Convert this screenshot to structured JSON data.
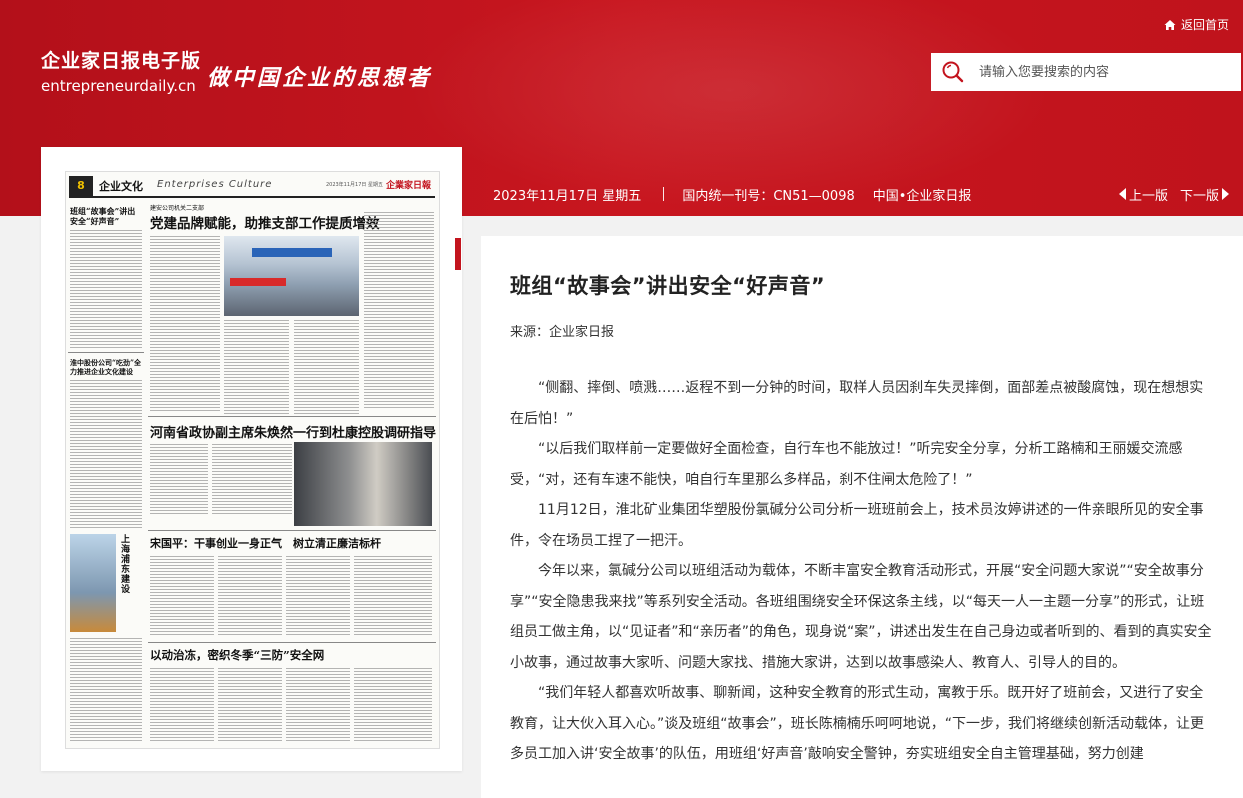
{
  "header": {
    "brand_cn": "企业家日报电子版",
    "brand_en": "entrepreneurdaily.cn",
    "slogan": "做中国企业的思想者",
    "home_label": "返回首页",
    "search_placeholder": "请输入您要搜索的内容",
    "home_icon": "home-icon",
    "search_icon": "search-icon"
  },
  "infobar": {
    "date": "2023年11月17日 星期五",
    "issn": "国内统一刊号：CN51—0098",
    "paper_name": "中国•企业家日报",
    "prev_label": "上一版",
    "next_label": "下一版"
  },
  "newspaper_page": {
    "page_number": "8",
    "section_cn": "企业文化",
    "section_en": "Enterprises Culture",
    "logo": "企業家日報",
    "date_line": "2023年11月17日 星期五",
    "headlines": {
      "h1_kicker": "建安公司机关二支部",
      "h1": "党建品牌赋能，助推支部工作提质增效",
      "side1": "班组“故事会”讲出安全“好声音”",
      "side2": "淮中股份公司“吃劲”全力推进企业文化建设",
      "h2": "河南省政协副主席朱焕然一行到杜康控股调研指导",
      "h3": "宋国平：干事创业一身正气　树立清正廉洁标杆",
      "h4": "以动治冻，密织冬季“三防”安全网",
      "v1": "上海浦东建设"
    }
  },
  "article": {
    "title": "班组“故事会”讲出安全“好声音”",
    "source": "来源：企业家日报",
    "paragraphs": [
      "“侧翻、摔倒、喷溅……返程不到一分钟的时间，取样人员因刹车失灵摔倒，面部差点被酸腐蚀，现在想想实在后怕！”",
      "“以后我们取样前一定要做好全面检查，自行车也不能放过！”听完安全分享，分析工路楠和王丽媛交流感受，“对，还有车速不能快，咱自行车里那么多样品，刹不住闸太危险了！”",
      "11月12日，淮北矿业集团华塑股份氯碱分公司分析一班班前会上，技术员汝婷讲述的一件亲眼所见的安全事件，令在场员工捏了一把汗。",
      "今年以来，氯碱分公司以班组活动为载体，不断丰富安全教育活动形式，开展“安全问题大家说”“安全故事分享”“安全隐患我来找”等系列安全活动。各班组围绕安全环保这条主线，以“每天一人一主题一分享”的形式，让班组员工做主角，以“见证者”和“亲历者”的角色，现身说“案”，讲述出发生在自己身边或者听到的、看到的真实安全小故事，通过故事大家听、问题大家找、措施大家讲，达到以故事感染人、教育人、引导人的目的。",
      "“我们年轻人都喜欢听故事、聊新闻，这种安全教育的形式生动，寓教于乐。既开好了班前会，又进行了安全教育，让大伙入耳入心。”谈及班组“故事会”，班长陈楠楠乐呵呵地说，“下一步，我们将继续创新活动载体，让更多员工加入讲‘安全故事’的队伍，用班组‘好声音’敲响安全警钟，夯实班组安全自主管理基础，努力创建"
    ]
  },
  "colors": {
    "brand_red": "#c3141e",
    "page_bg": "#f2f2f2",
    "panel_bg": "#ffffff"
  }
}
